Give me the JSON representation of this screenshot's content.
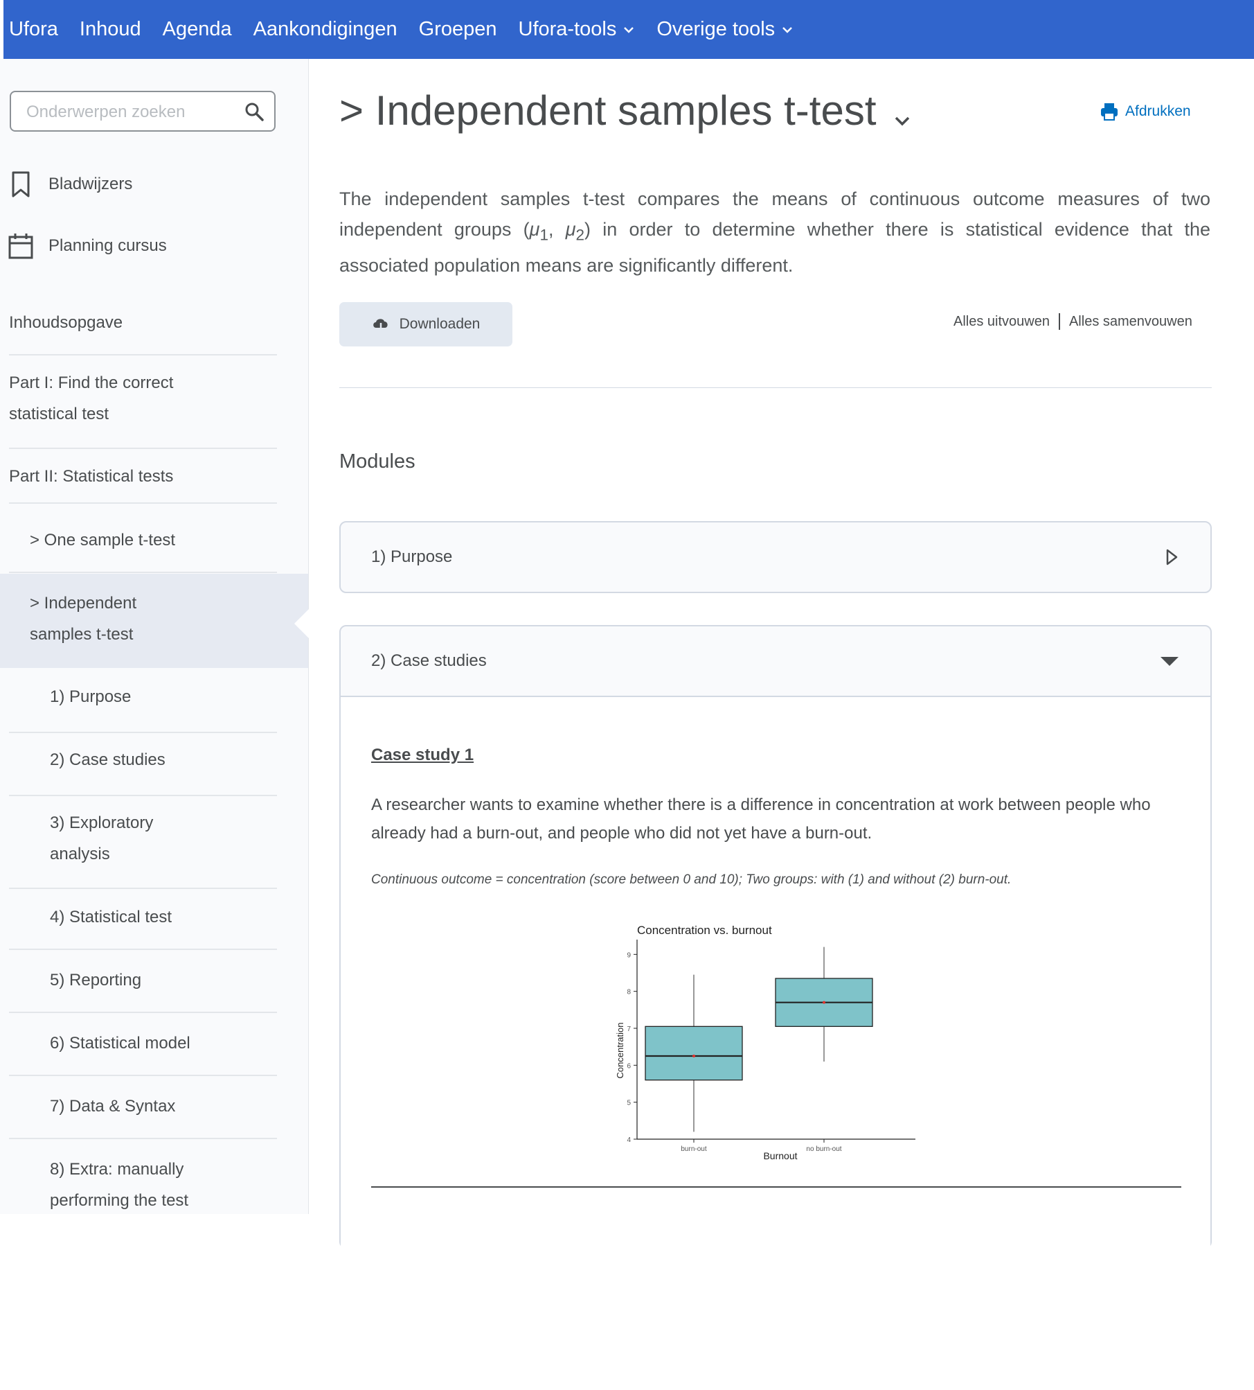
{
  "topnav": {
    "items": [
      {
        "label": "Ufora"
      },
      {
        "label": "Inhoud"
      },
      {
        "label": "Agenda"
      },
      {
        "label": "Aankondigingen"
      },
      {
        "label": "Groepen"
      },
      {
        "label": "Ufora-tools",
        "dropdown": true
      },
      {
        "label": "Overige tools",
        "dropdown": true
      }
    ]
  },
  "sidebar": {
    "search_placeholder": "Onderwerpen zoeken",
    "bookmarks_label": "Bladwijzers",
    "schedule_label": "Planning cursus",
    "toc": [
      {
        "label": "Inhoudsopgave"
      },
      {
        "label": "Part I: Find the correct statistical test"
      },
      {
        "label": "Part II: Statistical tests"
      },
      {
        "label": "> One sample t-test"
      },
      {
        "label": "> Independent samples t-test",
        "active": true
      },
      {
        "label": "1) Purpose"
      },
      {
        "label": "2) Case studies"
      },
      {
        "label": "3) Exploratory analysis"
      },
      {
        "label": "4) Statistical test"
      },
      {
        "label": "5) Reporting"
      },
      {
        "label": "6) Statistical model"
      },
      {
        "label": "7) Data & Syntax"
      },
      {
        "label": "8) Extra: manually performing the test"
      }
    ]
  },
  "main": {
    "title": "> Independent samples t-test",
    "print_label": "Afdrukken",
    "intro_pre": "The independent samples t-test compares the means of continuous outcome measures of two independent groups (",
    "intro_mu1": "μ",
    "intro_sub1": "1",
    "intro_comma": ", ",
    "intro_mu2": "μ",
    "intro_sub2": "2",
    "intro_post": ") in order to determine whether there is statistical evidence that the associated population means are significantly different.",
    "download_label": "Downloaden",
    "expand_all": "Alles uitvouwen",
    "collapse_all": "Alles samenvouwen",
    "modules_heading": "Modules",
    "modules": [
      {
        "title": "1) Purpose",
        "expanded": false
      },
      {
        "title": "2) Case studies",
        "expanded": true
      }
    ],
    "case_study": {
      "title": "Case study 1",
      "text": "A researcher wants to examine whether there is a difference in concentration at work between people who already had a burn-out, and people who did not yet have a burn-out.",
      "note": "Continuous outcome = concentration (score between 0 and 10); Two groups: with (1) and without (2) burn-out."
    }
  },
  "colors": {
    "nav": "#3165cc",
    "box_fill": "#7fc3c9",
    "link": "#006fbf"
  },
  "chart_data": {
    "type": "boxplot",
    "title": "Concentration vs. burnout",
    "xlabel": "Burnout",
    "ylabel": "Concentration",
    "ylim": [
      4,
      9.4
    ],
    "yticks": [
      "4",
      "5",
      "6",
      "7",
      "8",
      "9"
    ],
    "categories": [
      "burn-out",
      "no burn-out"
    ],
    "boxes": [
      {
        "category": "burn-out",
        "whisker_low": 4.2,
        "q1": 5.6,
        "median": 6.25,
        "q3": 7.05,
        "whisker_high": 8.45,
        "mean": 6.25
      },
      {
        "category": "no burn-out",
        "whisker_low": 6.1,
        "q1": 7.05,
        "median": 7.7,
        "q3": 8.35,
        "whisker_high": 9.2,
        "mean": 7.7
      }
    ]
  }
}
